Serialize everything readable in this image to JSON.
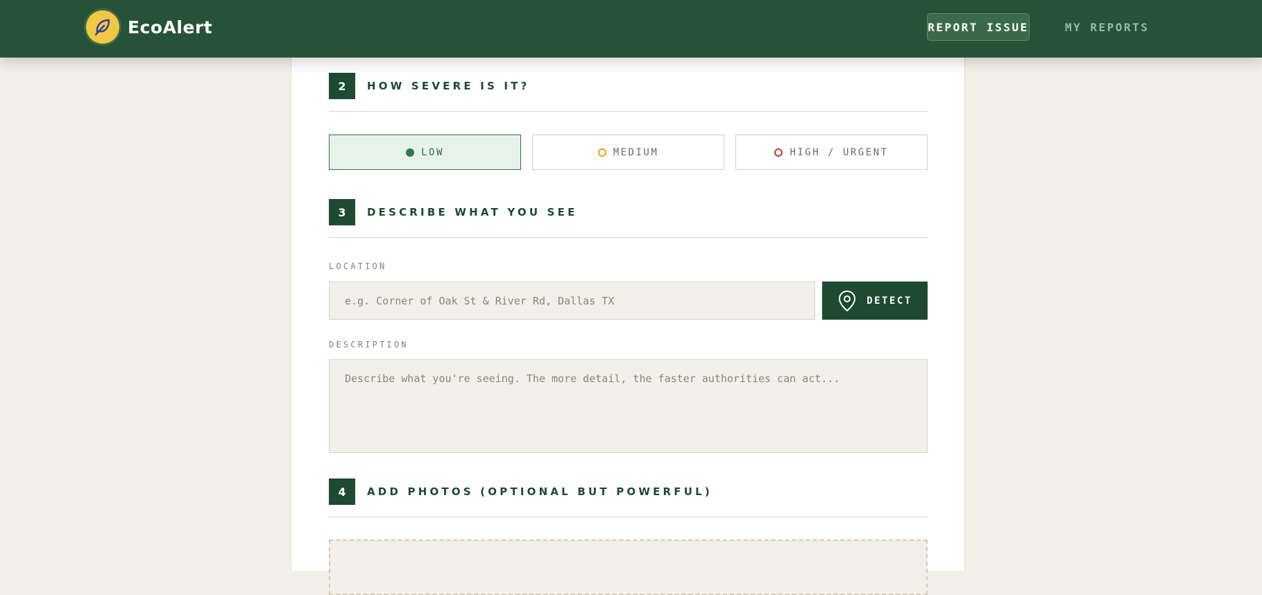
{
  "app": {
    "name": "EcoAlert",
    "logo_icon": "leaf-icon"
  },
  "nav": {
    "report_issue": "REPORT ISSUE",
    "my_reports": "MY REPORTS"
  },
  "sections": [
    {
      "number": "2",
      "title": "HOW SEVERE IS IT?"
    },
    {
      "number": "3",
      "title": "DESCRIBE WHAT YOU SEE"
    },
    {
      "number": "4",
      "title": "ADD PHOTOS (OPTIONAL BUT POWERFUL)"
    }
  ],
  "severity": {
    "selected": "LOW",
    "options": [
      {
        "label": "LOW",
        "color": "#2f7a4d"
      },
      {
        "label": "MEDIUM",
        "color": "#e6a21a"
      },
      {
        "label": "HIGH / URGENT",
        "color": "#c0392b"
      }
    ]
  },
  "location": {
    "label": "LOCATION",
    "placeholder": "e.g. Corner of Oak St & River Rd, Dallas TX",
    "detect_label": "DETECT",
    "detect_icon": "map-pin-icon"
  },
  "description": {
    "label": "DESCRIPTION",
    "placeholder": "Describe what you're seeing. The more detail, the faster authorities can act..."
  },
  "colors": {
    "brand_green": "#265238",
    "dark_green": "#1d4a30",
    "accent_yellow": "#f2c744",
    "background": "#f3f0e9"
  }
}
